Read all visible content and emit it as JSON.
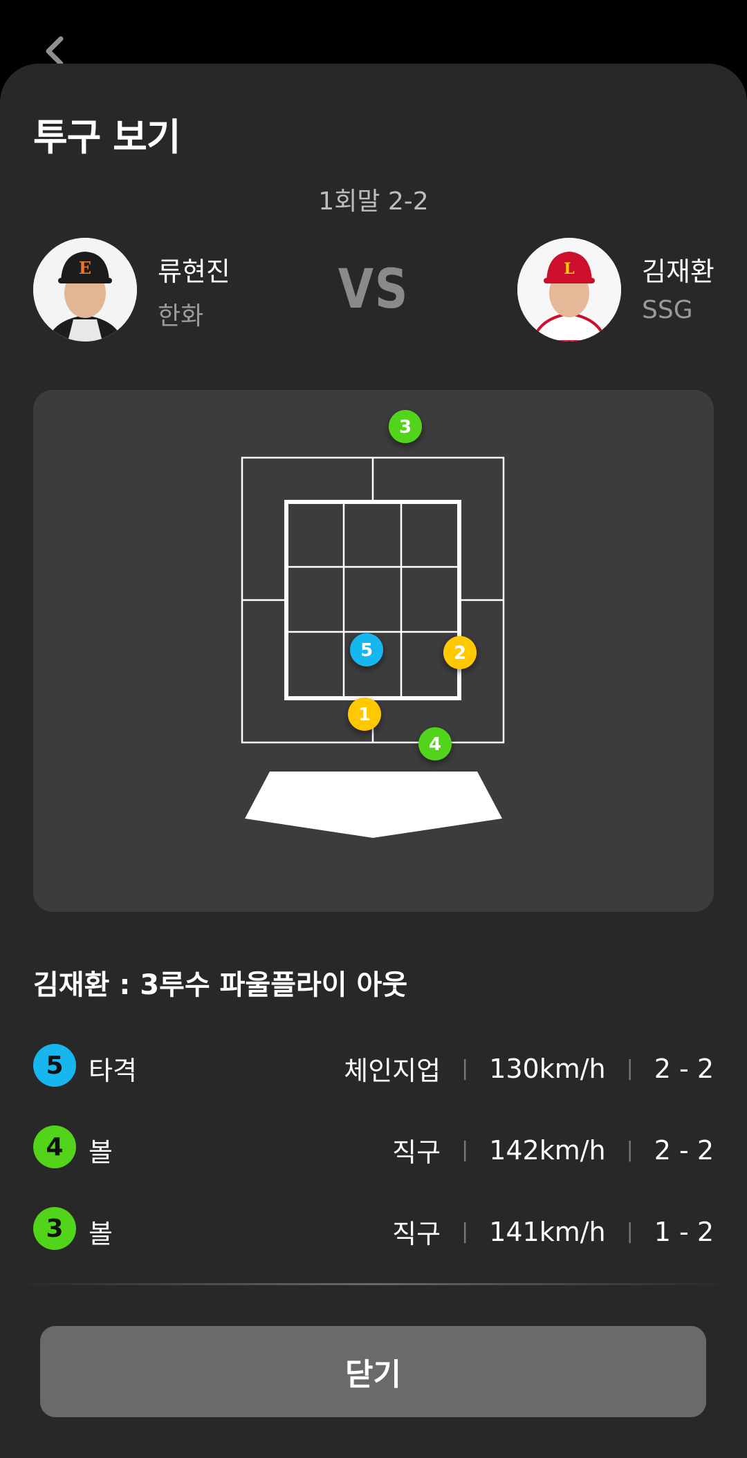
{
  "header": {
    "back_icon": "chevron-left-icon",
    "title": "투구 보기"
  },
  "game": {
    "inning_count": "1회말 2-2",
    "vs": "VS"
  },
  "pitcher": {
    "name": "류현진",
    "team": "한화",
    "cap_color": "#1c1c1c",
    "logo_color": "#f37321"
  },
  "batter": {
    "name": "김재환",
    "team": "SSG",
    "cap_color": "#ce0e2d"
  },
  "strike_zone": {
    "pitches": [
      {
        "number": "3",
        "color": "#52d41a"
      },
      {
        "number": "5",
        "color": "#18b6ef"
      },
      {
        "number": "2",
        "color": "#ffc800"
      },
      {
        "number": "1",
        "color": "#ffc800"
      },
      {
        "number": "4",
        "color": "#52d41a"
      }
    ]
  },
  "result": {
    "text": "김재환 : 3루수 파울플라이 아웃"
  },
  "pitch_list": [
    {
      "number": "5",
      "color": "#18b6ef",
      "result": "타격",
      "type": "체인지업",
      "speed": "130km/h",
      "count": "2 - 2"
    },
    {
      "number": "4",
      "color": "#52d41a",
      "result": "볼",
      "type": "직구",
      "speed": "142km/h",
      "count": "2 - 2"
    },
    {
      "number": "3",
      "color": "#52d41a",
      "result": "볼",
      "type": "직구",
      "speed": "141km/h",
      "count": "1 - 2"
    }
  ],
  "footer": {
    "close_label": "닫기"
  }
}
